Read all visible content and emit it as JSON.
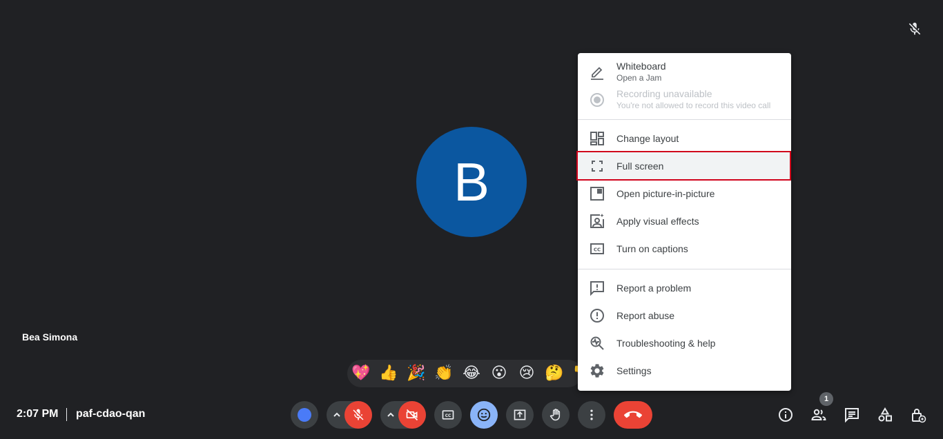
{
  "participant": {
    "initial": "B",
    "name": "Bea Simona",
    "avatar_color": "#0b57a0"
  },
  "meeting": {
    "time": "2:07 PM",
    "code": "paf-cdao-qan"
  },
  "menu": {
    "whiteboard": {
      "label": "Whiteboard",
      "sub": "Open a Jam",
      "icon": "pencil-icon"
    },
    "recording": {
      "label": "Recording unavailable",
      "sub": "You're not allowed to record this video call",
      "icon": "record-icon"
    },
    "items": [
      {
        "label": "Change layout",
        "icon": "layout-icon"
      },
      {
        "label": "Full screen",
        "icon": "fullscreen-icon"
      },
      {
        "label": "Open picture-in-picture",
        "icon": "pip-icon"
      },
      {
        "label": "Apply visual effects",
        "icon": "visual-effects-icon"
      },
      {
        "label": "Turn on captions",
        "icon": "captions-icon"
      },
      {
        "label": "Report a problem",
        "icon": "report-problem-icon"
      },
      {
        "label": "Report abuse",
        "icon": "report-abuse-icon"
      },
      {
        "label": "Troubleshooting & help",
        "icon": "troubleshoot-icon"
      },
      {
        "label": "Settings",
        "icon": "gear-icon"
      }
    ]
  },
  "emojis": [
    "💖",
    "👍",
    "🎉",
    "👏",
    "😂",
    "😮",
    "😢",
    "🤔",
    "👎"
  ],
  "people_count": "1",
  "colors": {
    "background": "#202124",
    "control": "#3c4043",
    "danger": "#ea4335",
    "highlight_border": "#d0021b",
    "emoji_active": "#8ab4f8"
  }
}
